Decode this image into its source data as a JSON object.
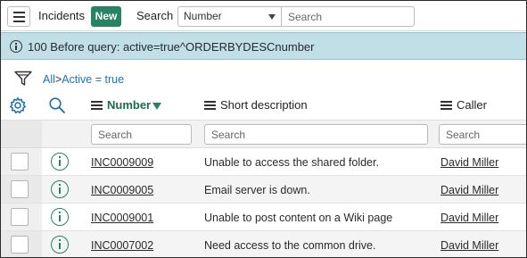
{
  "header": {
    "title": "Incidents",
    "new_label": "New",
    "search_label": "Search",
    "search_field_selected": "Number",
    "search_placeholder": "Search"
  },
  "banner": {
    "text": "100 Before query: active=true^ORDERBYDESCnumber"
  },
  "breadcrumb": {
    "all": "All",
    "separator": ">",
    "active": "Active = true"
  },
  "columns": {
    "number": "Number",
    "short_description": "Short description",
    "caller": "Caller"
  },
  "column_search_placeholder": "Search",
  "rows": [
    {
      "number": "INC0009009",
      "short_description": "Unable to access the shared folder.",
      "caller": "David Miller"
    },
    {
      "number": "INC0009005",
      "short_description": "Email server is down.",
      "caller": "David Miller"
    },
    {
      "number": "INC0009001",
      "short_description": "Unable to post content on a Wiki page",
      "caller": "David Miller"
    },
    {
      "number": "INC0007002",
      "short_description": "Need access to the common drive.",
      "caller": "David Miller"
    }
  ],
  "colors": {
    "accent": "#278363",
    "banner_bg": "#c0dfe6"
  }
}
